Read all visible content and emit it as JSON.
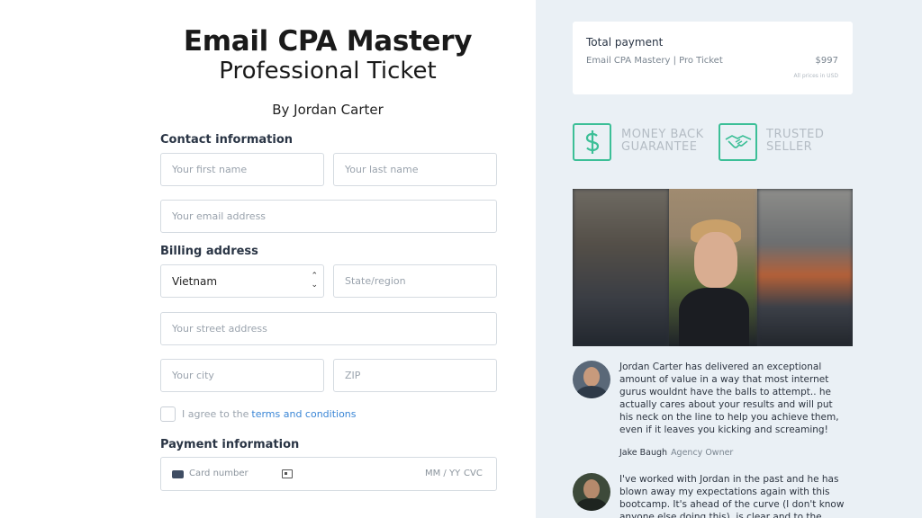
{
  "header": {
    "title": "Email CPA Mastery",
    "subtitle": "Professional Ticket",
    "author": "By Jordan Carter"
  },
  "contact": {
    "label": "Contact information",
    "first_name_placeholder": "Your first name",
    "last_name_placeholder": "Your last name",
    "email_placeholder": "Your email address"
  },
  "billing": {
    "label": "Billing address",
    "country_value": "Vietnam",
    "state_placeholder": "State/region",
    "street_placeholder": "Your street address",
    "city_placeholder": "Your city",
    "zip_placeholder": "ZIP"
  },
  "terms": {
    "text": "I agree to the",
    "link": "terms and conditions"
  },
  "payment": {
    "label": "Payment information",
    "card_placeholder": "Card number",
    "expiry_placeholder": "MM / YY",
    "cvc_placeholder": "CVC",
    "icons": [
      "card-icon",
      "id-card-icon"
    ]
  },
  "summary": {
    "title": "Total payment",
    "item": "Email CPA Mastery | Pro Ticket",
    "price": "$997",
    "note": "All prices in USD"
  },
  "badges": [
    {
      "icon": "dollar-icon",
      "line1": "MONEY BACK",
      "line2": "GUARANTEE"
    },
    {
      "icon": "handshake-icon",
      "line1": "TRUSTED",
      "line2": "SELLER"
    }
  ],
  "testimonials": [
    {
      "text": "Jordan Carter has delivered an exceptional amount of value in a way that most internet gurus wouldnt have the balls to attempt.. he actually cares about your results and will put his neck on the line to help you achieve them, even if it leaves you kicking and screaming!",
      "name": "Jake Baugh",
      "role": "Agency Owner"
    },
    {
      "text": "I've worked with Jordan in the past and he has blown away my expectations again with this bootcamp. It's ahead of the curve (I don't know anyone else doing this), is clear and to the point, and is full of actionable"
    }
  ],
  "colors": {
    "accent_green": "#3cbf97",
    "link_blue": "#3a86d6",
    "right_panel_bg": "#eaf0f5"
  }
}
